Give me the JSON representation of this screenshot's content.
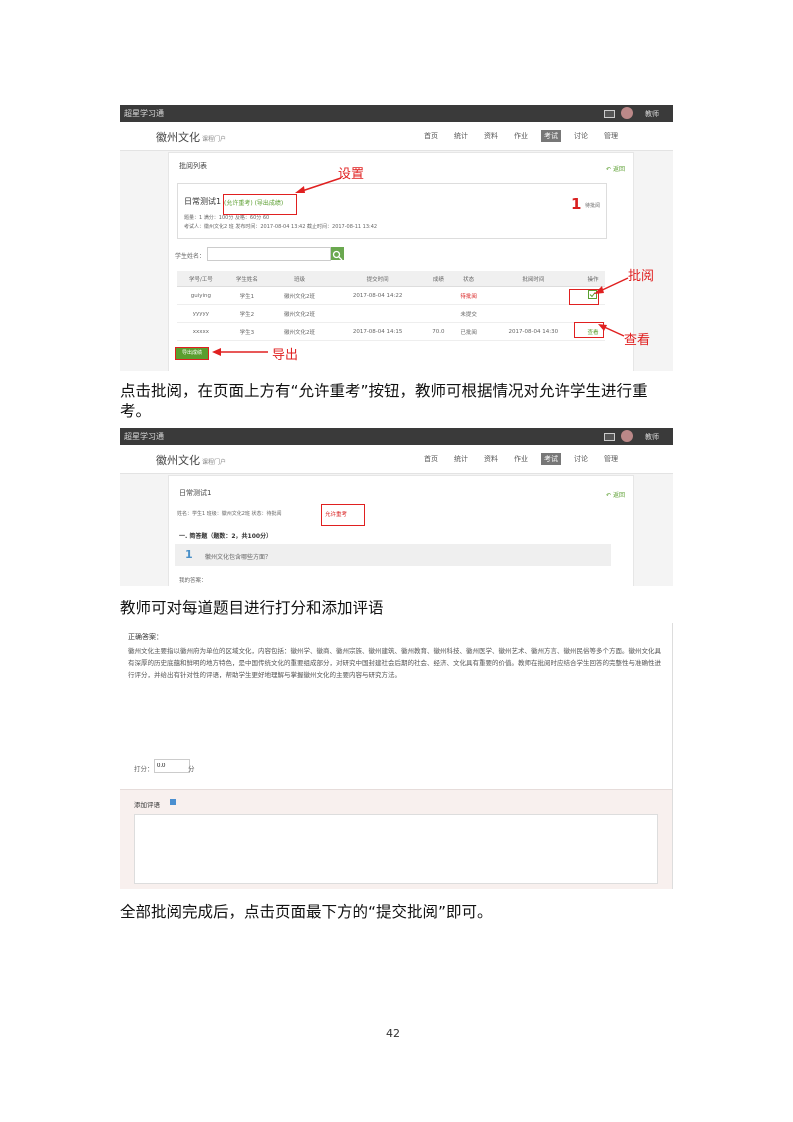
{
  "shot1": {
    "logo": "超星学习通",
    "user": "教师",
    "course_name": "徽州文化",
    "course_sub": "课程门户",
    "nav": [
      "首页",
      "统计",
      "资料",
      "作业",
      "考试",
      "讨论",
      "管理"
    ],
    "nav_active": 4,
    "panel_title": "批阅列表",
    "back": "返回",
    "exam_title": "日常测试1",
    "tags": "(允许重考) (导出成绩)",
    "meta_line1": "题量：1  满分：100分  及格：60分  60",
    "meta_line2": "考试人：徽州文化2 班  发布时间：2017-08-04 13:42  截止时间：2017-08-11 13:42",
    "pending_count": "1",
    "pending_label": "待批阅",
    "search_label": "学生姓名：",
    "columns": [
      "学号/工号",
      "学生姓名",
      "班级",
      "提交时间",
      "成绩",
      "状态",
      "批阅时间",
      "操作"
    ],
    "rows": [
      [
        "guiying",
        "学生1",
        "徽州文化2班",
        "2017-08-04 14:22",
        "",
        "待批阅",
        "",
        ""
      ],
      [
        "yyyyy",
        "学生2",
        "徽州文化2班",
        "",
        "",
        "未提交",
        "",
        ""
      ],
      [
        "xxxxx",
        "学生3",
        "徽州文化2班",
        "2017-08-04 14:15",
        "70.0",
        "已批阅",
        "2017-08-04 14:30",
        "查看"
      ]
    ],
    "export_btn": "导出成绩",
    "annot_setting": "设置",
    "annot_review": "批阅",
    "annot_view": "查看",
    "annot_export": "导出"
  },
  "para1": "点击批阅，在页面上方有“允许重考”按钮，教师可根据情况对允许学生进行重考。",
  "shot2": {
    "logo": "超星学习通",
    "user": "教师",
    "course_name": "徽州文化",
    "course_sub": "课程门户",
    "nav": [
      "首页",
      "统计",
      "资料",
      "作业",
      "考试",
      "讨论",
      "管理"
    ],
    "nav_active": 4,
    "exam_title": "日常测试1",
    "back": "返回",
    "info_line": "姓名：学生1  班级：徽州文化2班  状态：待批阅",
    "retake": "允许重考",
    "section": "一. 简答题（题数：2，共100分）",
    "q_num": "1",
    "q_text": "徽州文化包含哪些方面？",
    "answer_label": "我的答案："
  },
  "para2": "教师可对每道题目进行打分和添加评语",
  "shot3": {
    "answer_title": "正确答案：",
    "answer_text": "徽州文化主要指以徽州府为单位的区域文化，内容包括：徽州学、徽商、徽州宗族、徽州建筑、徽州教育、徽州科技、徽州医学、徽州艺术、徽州方言、徽州民俗等多个方面。徽州文化具有深厚的历史底蕴和鲜明的地方特色，是中国传统文化的重要组成部分，对研究中国封建社会后期的社会、经济、文化具有重要的价值。教师在批阅时应结合学生回答的完整性与准确性进行评分，并给出有针对性的评语，帮助学生更好地理解与掌握徽州文化的主要内容与研究方法。",
    "score_label": "打分：",
    "score_value": "0.0",
    "score_unit": "分",
    "comment_label": "添加评语"
  },
  "para3": "全部批阅完成后，点击页面最下方的“提交批阅”即可。",
  "page_number": "42"
}
